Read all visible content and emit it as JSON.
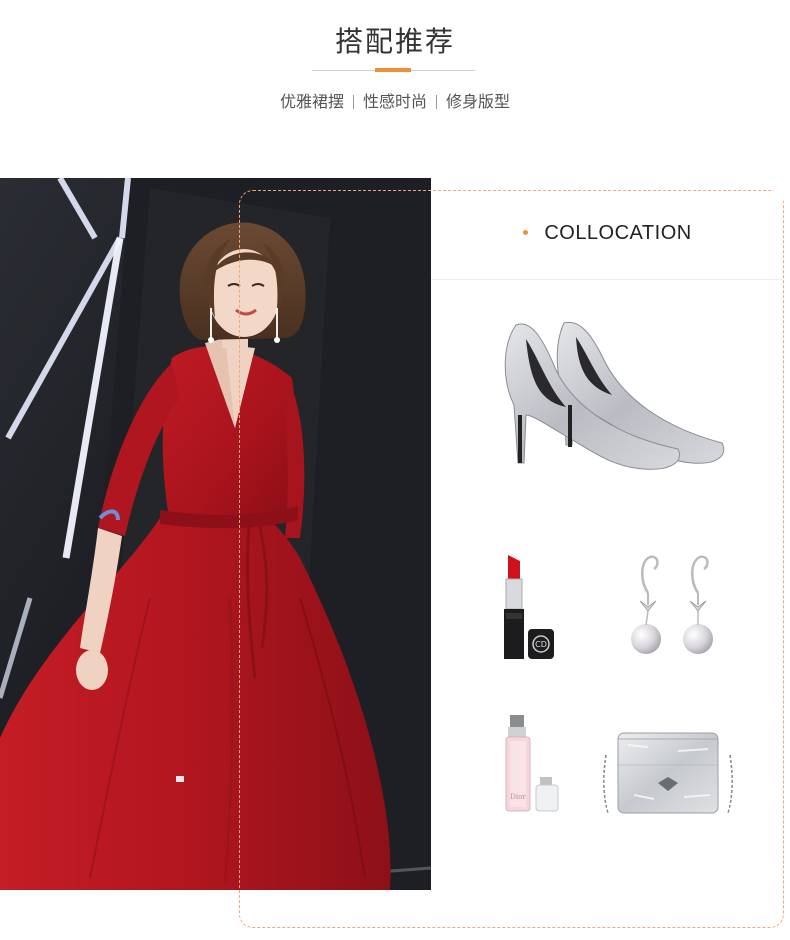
{
  "header": {
    "title": "搭配推荐",
    "subtitle_items": [
      "优雅裙摆",
      "性感时尚",
      "修身版型"
    ]
  },
  "collocation": {
    "heading": "COLLOCATION"
  },
  "products": [
    {
      "icon": "silver-pumps-icon"
    },
    {
      "icon": "lipstick-icon"
    },
    {
      "icon": "pearl-earrings-icon"
    },
    {
      "icon": "perfume-icon"
    },
    {
      "icon": "silver-handbag-icon"
    }
  ],
  "colors": {
    "accent": "#f08f3a",
    "card_border": "#f2a77a",
    "dress_red": "#b3161f",
    "silver": "#c9ccd1"
  }
}
